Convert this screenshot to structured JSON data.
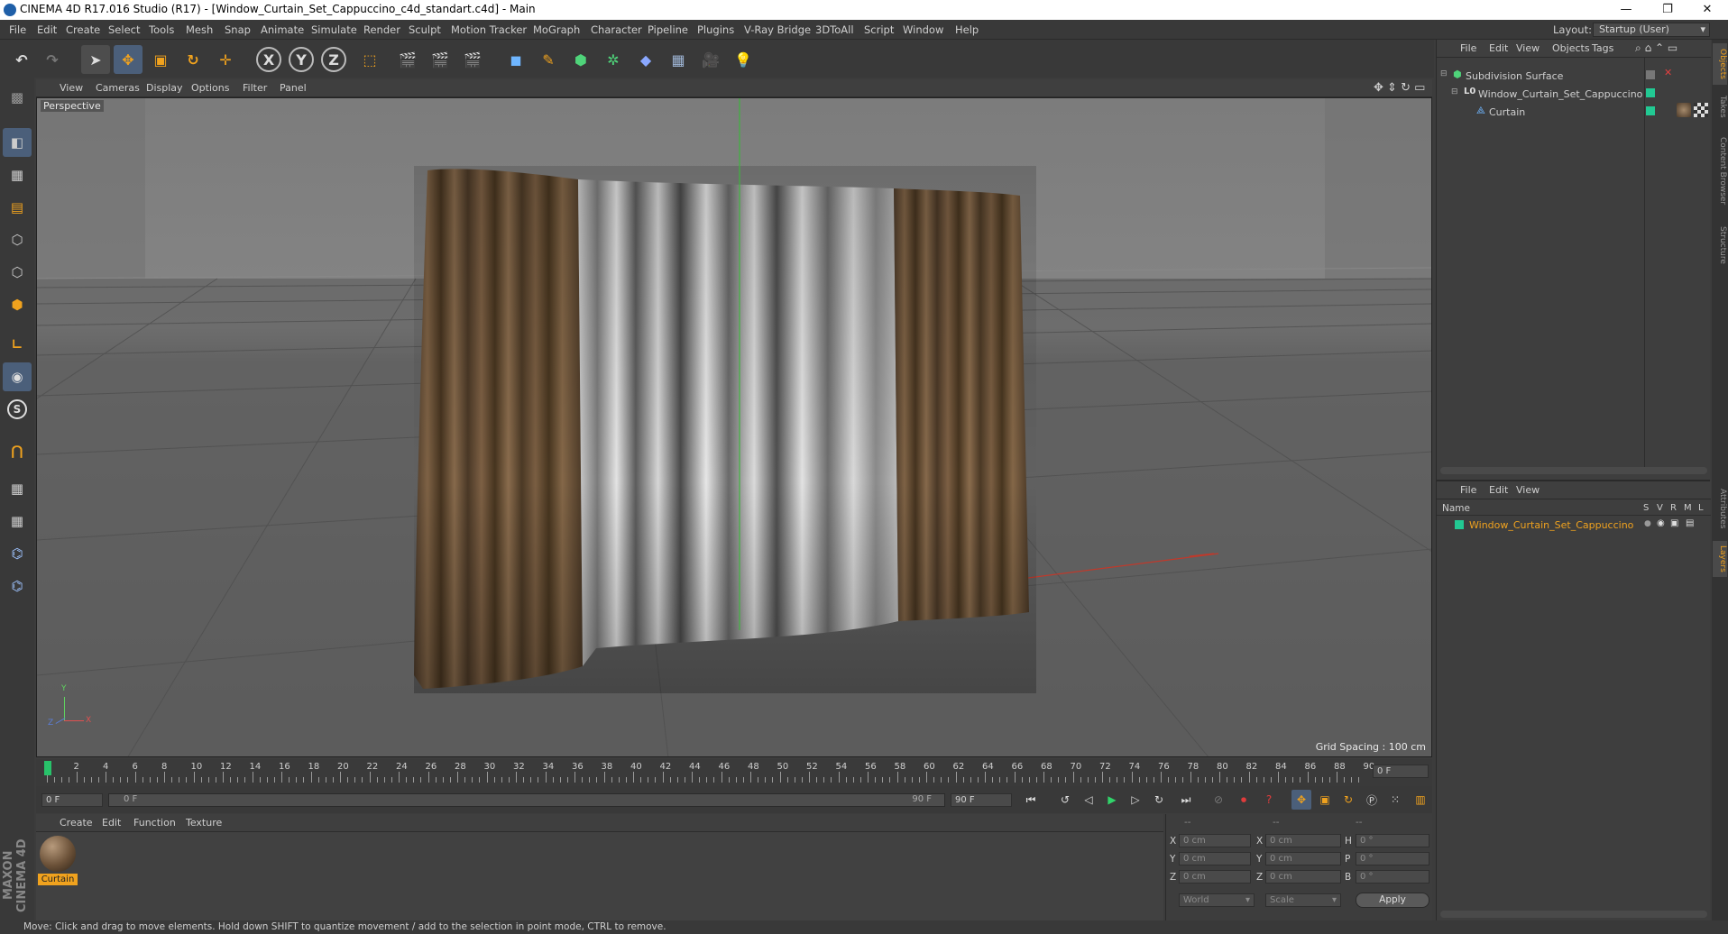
{
  "window": {
    "title": "CINEMA 4D R17.016 Studio (R17) - [Window_Curtain_Set_Cappuccino_c4d_standart.c4d] - Main",
    "minimize": "—",
    "restore": "❐",
    "close": "✕"
  },
  "menu": [
    "File",
    "Edit",
    "Create",
    "Select",
    "Tools",
    "Mesh",
    "Snap",
    "Animate",
    "Simulate",
    "Render",
    "Sculpt",
    "Motion Tracker",
    "MoGraph",
    "Character",
    "Pipeline",
    "Plugins",
    "V-Ray Bridge",
    "3DToAll",
    "Script",
    "Window",
    "Help"
  ],
  "layout": {
    "label": "Layout:",
    "value": "Startup (User)"
  },
  "toolbar": {
    "x_label": "X",
    "y_label": "Y",
    "z_label": "Z"
  },
  "left_tools": {
    "snap_label": "S"
  },
  "viewport": {
    "menu": [
      "View",
      "Cameras",
      "Display",
      "Options",
      "Filter",
      "Panel"
    ],
    "label": "Perspective",
    "grid_spacing": "Grid Spacing : 100 cm",
    "axis_x": "X",
    "axis_y": "Y",
    "axis_z": "Z"
  },
  "timeline": {
    "ticks": [
      "0",
      "2",
      "4",
      "6",
      "8",
      "10",
      "12",
      "14",
      "16",
      "18",
      "20",
      "22",
      "24",
      "26",
      "28",
      "30",
      "32",
      "34",
      "36",
      "38",
      "40",
      "42",
      "44",
      "46",
      "48",
      "50",
      "52",
      "54",
      "56",
      "58",
      "60",
      "62",
      "64",
      "66",
      "68",
      "70",
      "72",
      "74",
      "76",
      "78",
      "80",
      "82",
      "84",
      "86",
      "88",
      "90"
    ],
    "current_frame": "0 F",
    "start_field": "0 F",
    "range_start": "0 F",
    "range_end": "90 F",
    "end_field": "90 F"
  },
  "materials": {
    "menu": [
      "Create",
      "Edit",
      "Function",
      "Texture"
    ],
    "items": [
      {
        "name": "Curtain"
      }
    ]
  },
  "coords": {
    "headers": [
      "--",
      "--",
      "--"
    ],
    "rows": [
      {
        "a": "X",
        "av": "0 cm",
        "b": "X",
        "bv": "0 cm",
        "c": "H",
        "cv": "0 °"
      },
      {
        "a": "Y",
        "av": "0 cm",
        "b": "Y",
        "bv": "0 cm",
        "c": "P",
        "cv": "0 °"
      },
      {
        "a": "Z",
        "av": "0 cm",
        "b": "Z",
        "bv": "0 cm",
        "c": "B",
        "cv": "0 °"
      }
    ],
    "mode1": "World",
    "mode2": "Scale",
    "apply": "Apply"
  },
  "objects_panel": {
    "menu": [
      "File",
      "Edit",
      "View",
      "Objects",
      "Tags"
    ],
    "tree": [
      {
        "name": "Subdivision Surface"
      },
      {
        "name": "Window_Curtain_Set_Cappuccino"
      },
      {
        "name": "Curtain"
      }
    ]
  },
  "layers_panel": {
    "menu": [
      "File",
      "Edit",
      "View"
    ],
    "col_name": "Name",
    "cols": [
      "S",
      "V",
      "R",
      "M",
      "L"
    ],
    "layers": [
      {
        "name": "Window_Curtain_Set_Cappuccino"
      }
    ]
  },
  "right_tabs": [
    "Objects",
    "Takes",
    "Content Browser",
    "Structure",
    "Attributes",
    "Layers"
  ],
  "status": "Move: Click and drag to move elements. Hold down SHIFT to quantize movement / add to the selection in point mode, CTRL to remove.",
  "brand": "MAXON CINEMA 4D",
  "colors": {
    "accent_orange": "#f0a21e",
    "layer_green": "#22c993",
    "curtain_brown": "#6b5138"
  }
}
